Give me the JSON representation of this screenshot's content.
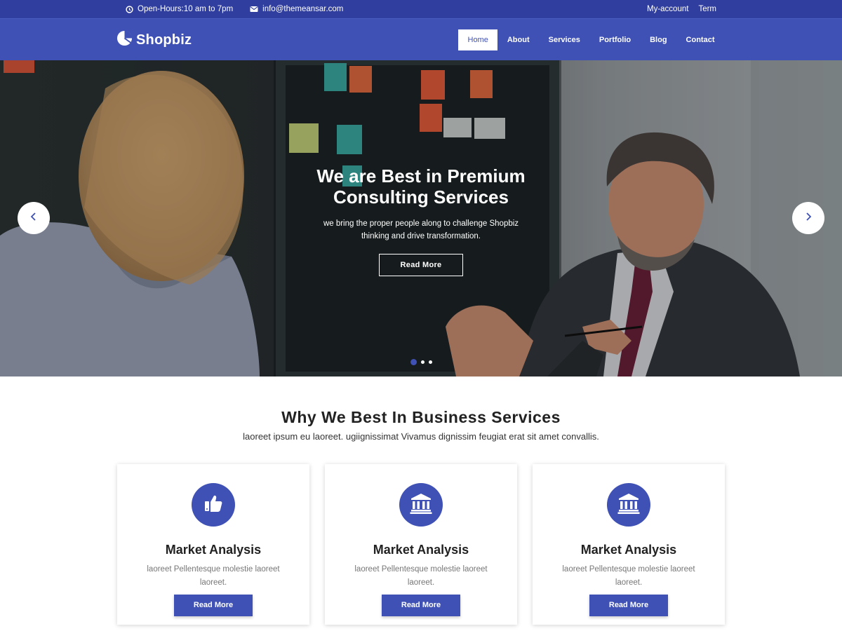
{
  "topbar": {
    "hours": "Open-Hours:10 am to 7pm",
    "email": "info@themeansar.com",
    "links": [
      "My-account",
      "Term"
    ]
  },
  "brand": {
    "name": "Shopbiz",
    "accent": "#3f51b5",
    "dark_accent": "#303f9f"
  },
  "nav": {
    "items": [
      {
        "label": "Home",
        "active": true
      },
      {
        "label": "About",
        "active": false
      },
      {
        "label": "Services",
        "active": false
      },
      {
        "label": "Portfolio",
        "active": false
      },
      {
        "label": "Blog",
        "active": false
      },
      {
        "label": "Contact",
        "active": false
      }
    ]
  },
  "hero": {
    "title": "We are Best in Premium Consulting Services",
    "subtitle": "we bring the proper people along to challenge Shopbiz thinking and drive transformation.",
    "button": "Read More",
    "slide_count": 3,
    "active_slide": 1
  },
  "services": {
    "title": "Why We Best In Business Services",
    "subtitle": "laoreet ipsum eu laoreet. ugiignissimat Vivamus dignissim feugiat erat sit amet convallis.",
    "cards": [
      {
        "icon": "thumbs-up-icon",
        "title": "Market Analysis",
        "text": "laoreet Pellentesque molestie laoreet laoreet.",
        "button": "Read More"
      },
      {
        "icon": "bank-icon",
        "title": "Market Analysis",
        "text": "laoreet Pellentesque molestie laoreet laoreet.",
        "button": "Read More"
      },
      {
        "icon": "bank-icon",
        "title": "Market Analysis",
        "text": "laoreet Pellentesque molestie laoreet laoreet.",
        "button": "Read More"
      }
    ]
  }
}
